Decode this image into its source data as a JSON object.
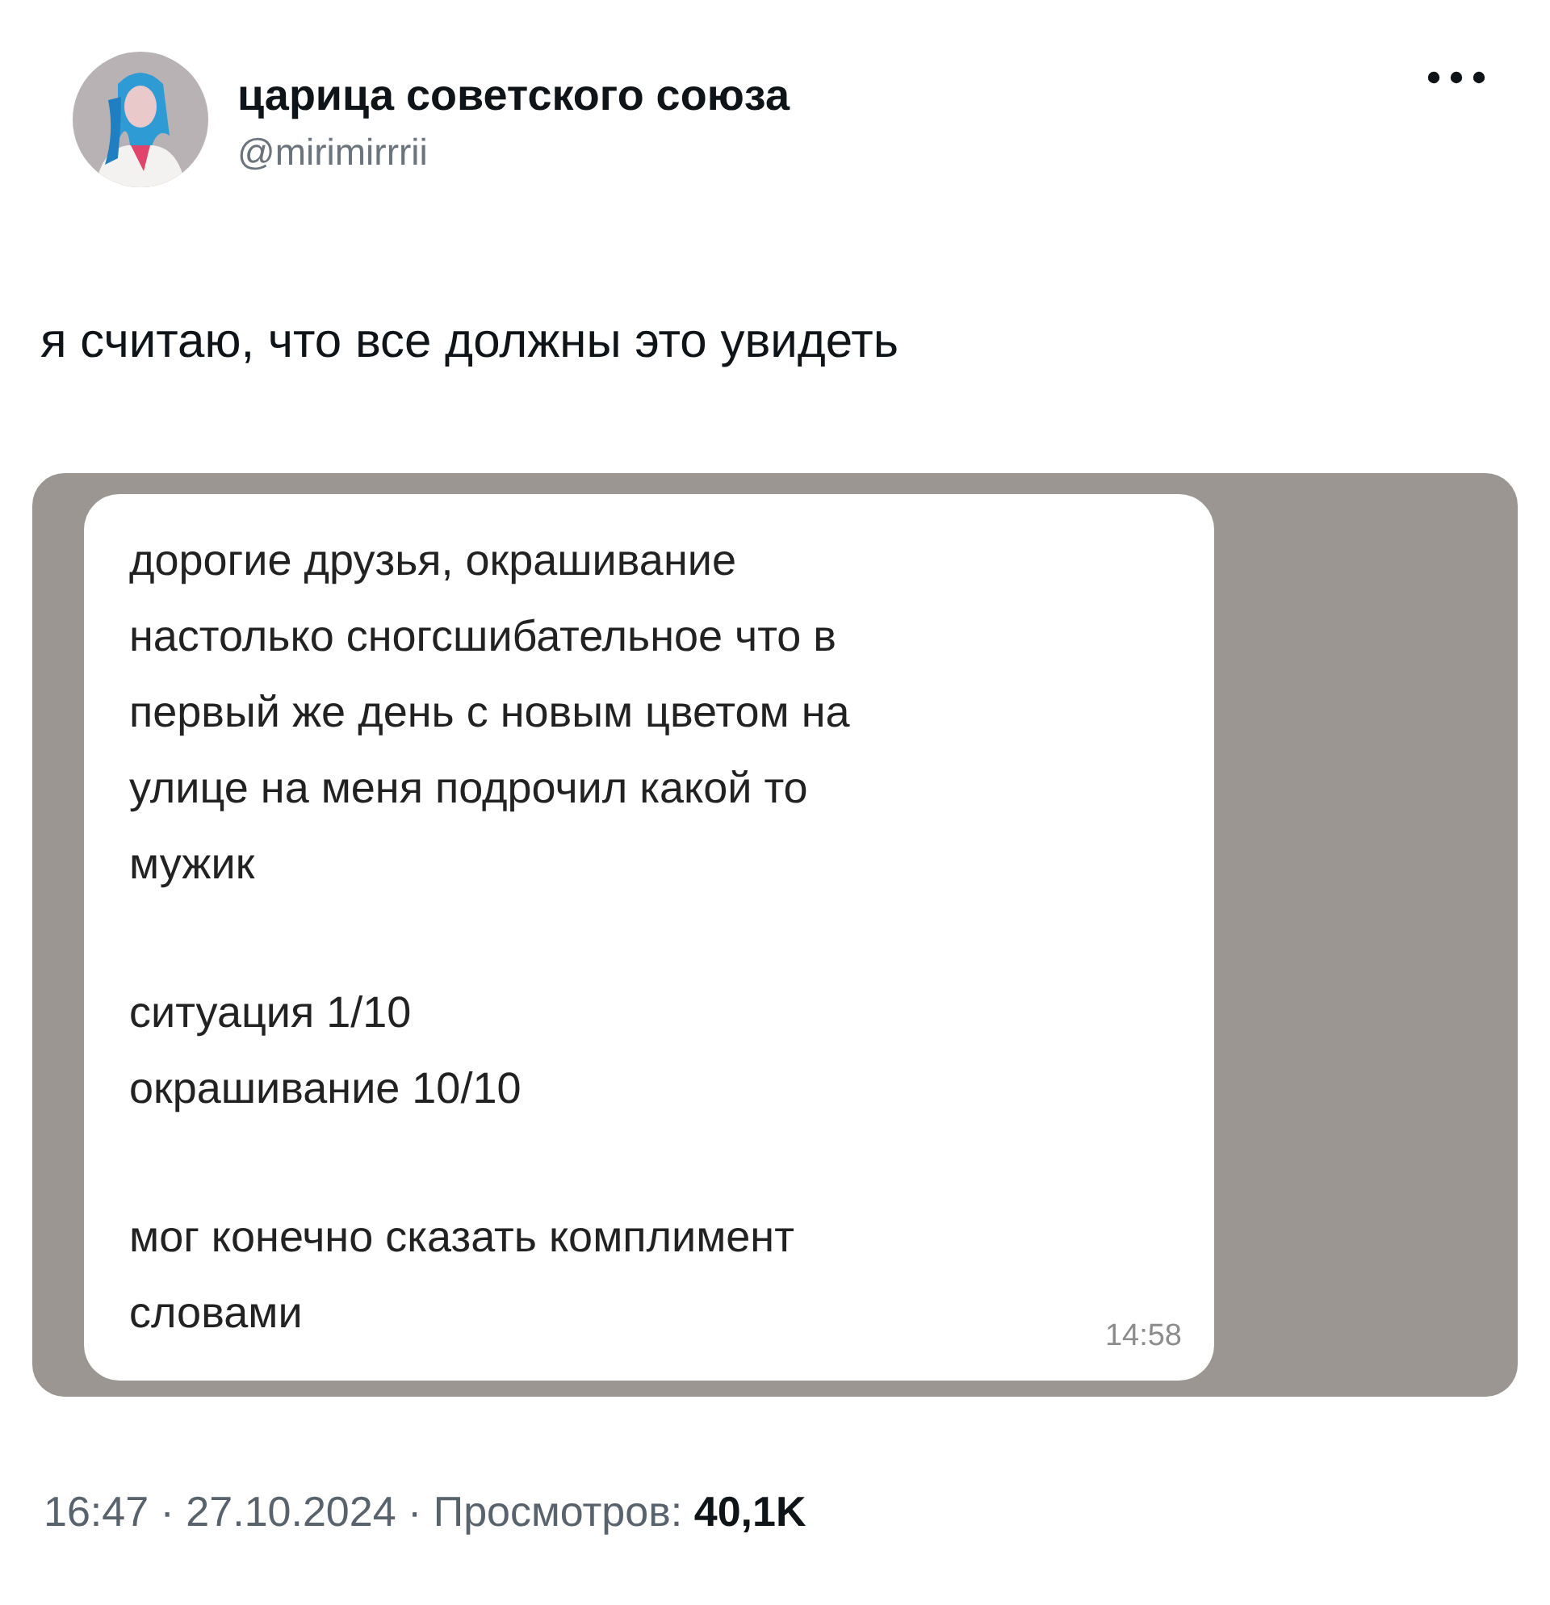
{
  "author": {
    "name": "царица советского союза",
    "handle": "@mirimirrrii"
  },
  "text": "я считаю, что все должны это увидеть",
  "attachment": {
    "kind": "picture",
    "message": {
      "paragraphs": [
        "дорогие друзья, окрашивание\nнастолько сногсшибательное что в\nпервый же день с новым цветом на\nулице на меня подрочил какой то\nмужик",
        "ситуация 1/10\nокрашивание 10/10",
        "мог конечно сказать комплимент\nсловами"
      ],
      "time": "14:58"
    }
  },
  "footer": "16:47 · 27.10.2024 · Просмотров: **40,1K**"
}
